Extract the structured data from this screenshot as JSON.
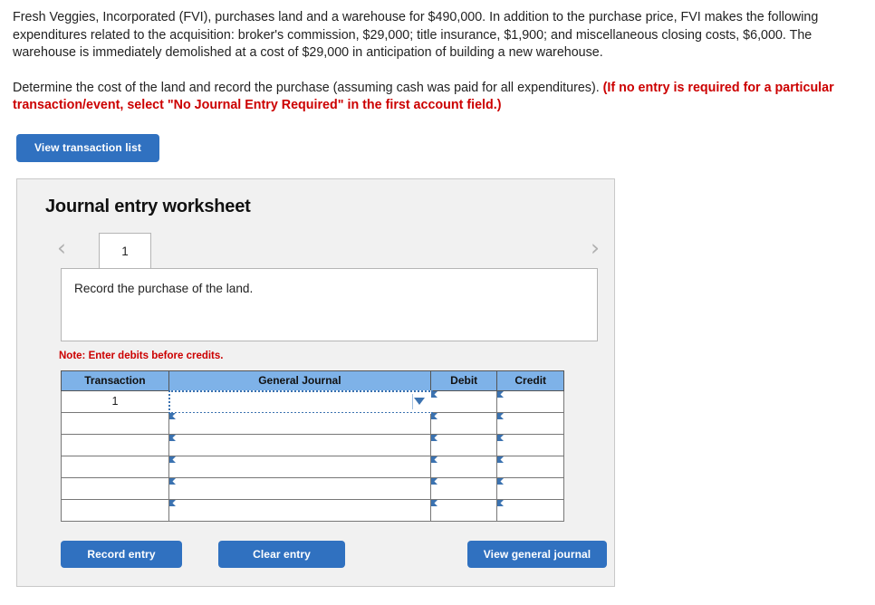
{
  "question": {
    "paragraph1": "Fresh Veggies, Incorporated (FVI), purchases land and a warehouse for $490,000. In addition to the purchase price, FVI makes the following expenditures related to the acquisition: broker's commission, $29,000; title insurance, $1,900; and miscellaneous closing costs, $6,000. The warehouse is immediately demolished at a cost of $29,000 in anticipation of building a new warehouse.",
    "paragraph2_plain": "Determine the cost of the land and record the purchase (assuming cash was paid for all expenditures). ",
    "paragraph2_red": "(If no entry is required for a particular transaction/event, select \"No Journal Entry Required\" in the first account field.)"
  },
  "toolbar": {
    "view_transaction_list_label": "View transaction list"
  },
  "worksheet": {
    "title": "Journal entry worksheet",
    "nav": {
      "prev_icon": "chevron-left-icon",
      "prev_glyph": "‹",
      "next_icon": "chevron-right-icon",
      "next_glyph": "›"
    },
    "tabs": [
      {
        "label": "1",
        "active": true
      }
    ],
    "description": "Record the purchase of the land.",
    "note": "Note: Enter debits before credits.",
    "table": {
      "headers": [
        "Transaction",
        "General Journal",
        "Debit",
        "Credit"
      ],
      "rows": [
        {
          "transaction": "1",
          "general_journal": "",
          "debit": "",
          "credit": ""
        },
        {
          "transaction": "",
          "general_journal": "",
          "debit": "",
          "credit": ""
        },
        {
          "transaction": "",
          "general_journal": "",
          "debit": "",
          "credit": ""
        },
        {
          "transaction": "",
          "general_journal": "",
          "debit": "",
          "credit": ""
        },
        {
          "transaction": "",
          "general_journal": "",
          "debit": "",
          "credit": ""
        },
        {
          "transaction": "",
          "general_journal": "",
          "debit": "",
          "credit": ""
        }
      ]
    },
    "buttons": {
      "record_entry": "Record entry",
      "clear_entry": "Clear entry",
      "view_general_journal": "View general journal"
    }
  },
  "colors": {
    "button_blue": "#3071c0",
    "table_header_blue": "#7eb2e8",
    "cell_border_blue": "#3b72b0",
    "note_red": "#cc0000",
    "panel_gray": "#f1f1f1"
  }
}
